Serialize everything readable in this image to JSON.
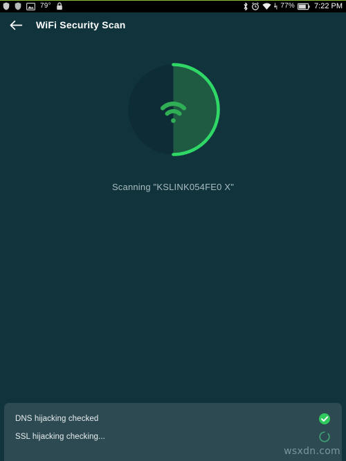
{
  "statusbar": {
    "left_icons": [
      "shield-icon",
      "shield-icon",
      "screenshot-icon"
    ],
    "temperature": "79°",
    "lock_icon": "lock-icon",
    "right_icons": [
      "bluetooth-icon",
      "alarm-icon",
      "wifi-icon"
    ],
    "battery_percent": "77%",
    "time": "7:22 PM"
  },
  "appbar": {
    "back_icon": "arrow-left-icon",
    "title": "WiFi Security Scan"
  },
  "scan": {
    "network_name": "KSLINK054FE0 X",
    "status_text": "Scanning \"KSLINK054FE0 X\"",
    "progress_percent": 50,
    "center_icon": "wifi-icon",
    "accent_color": "#2fd866",
    "fill_color": "#1f5a42",
    "track_color": "#0e2c35"
  },
  "results": {
    "items": [
      {
        "label": "DNS hijacking checked",
        "status": "checked",
        "status_icon": "check-circle-icon"
      },
      {
        "label": "SSL hijacking checking...",
        "status": "checking",
        "status_icon": "spinner-icon"
      }
    ]
  },
  "watermark": "wsxdn.com",
  "colors": {
    "background": "#10333c",
    "panel": "#2d4a52",
    "accent_green": "#2fd866",
    "status_bar": "#000000",
    "top_rule": "#8fbf3f"
  }
}
